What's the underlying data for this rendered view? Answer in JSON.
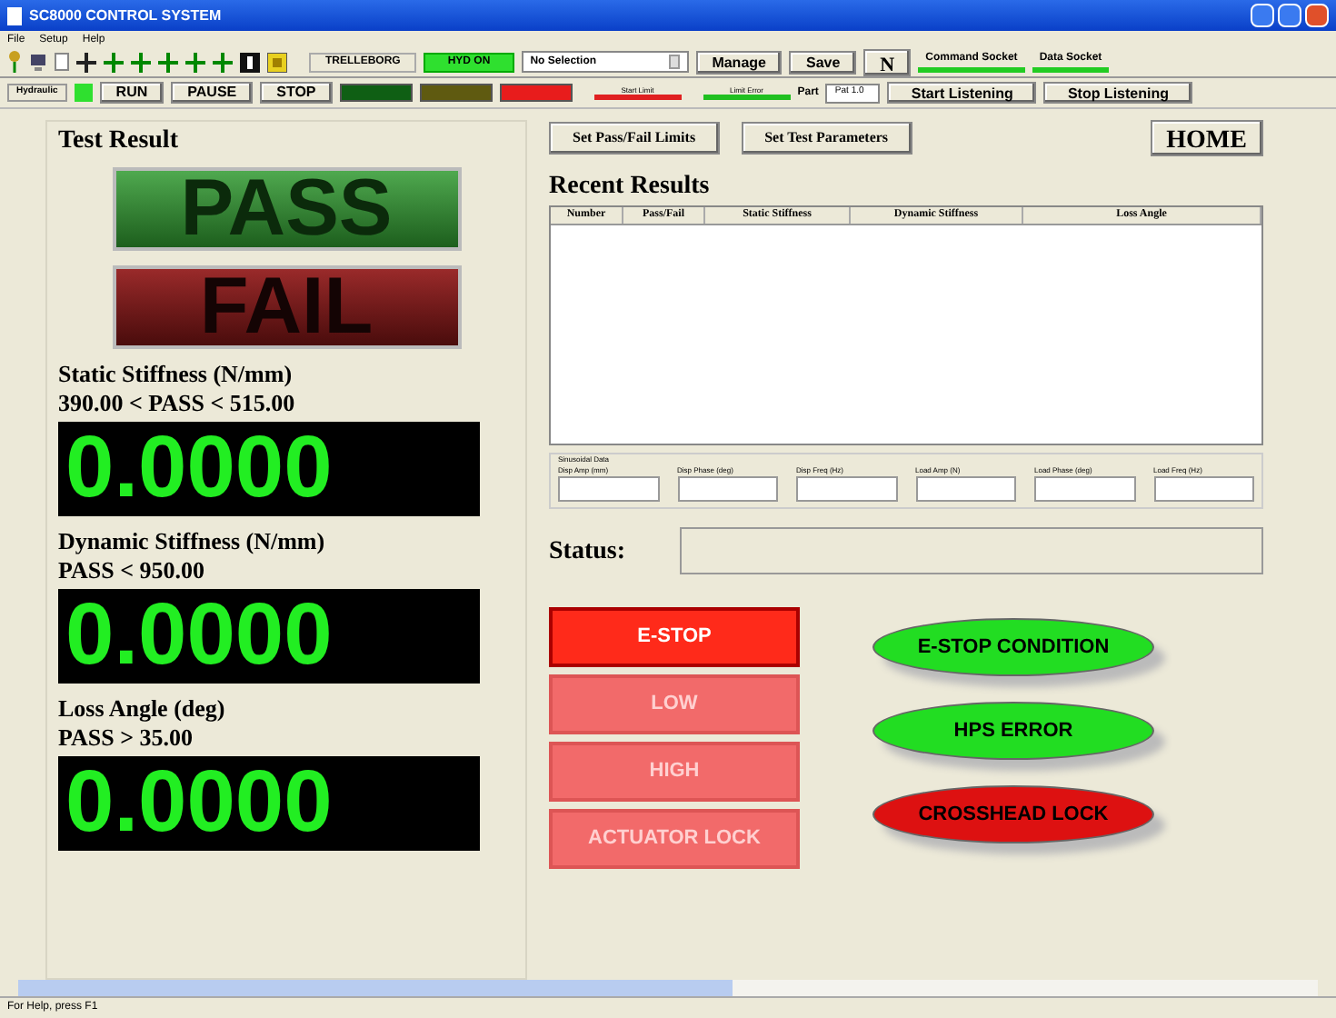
{
  "window": {
    "title": "SC8000 CONTROL SYSTEM"
  },
  "menu": [
    "File",
    "Setup",
    "Help"
  ],
  "toolbar": {
    "company": "TRELLEBORG",
    "hydraulics": "HYD ON",
    "selection": "No Selection",
    "buttons": [
      "Manage",
      "Save"
    ],
    "n_button": "N",
    "sockets": [
      {
        "label": "Command Socket",
        "connected": true
      },
      {
        "label": "Data Socket",
        "connected": true
      }
    ]
  },
  "control_bar": {
    "mode": "Hydraulic",
    "mode_on": true,
    "run_buttons": [
      "RUN",
      "PAUSE",
      "STOP"
    ],
    "lamps": [
      {
        "color": "#0f5f14"
      },
      {
        "color": "#5f5a10"
      },
      {
        "color": "#e81c1c"
      }
    ],
    "limit_bars": [
      {
        "label": "Start Limit",
        "color": "#e02020"
      },
      {
        "label": "Limit Error",
        "color": "#20c020"
      }
    ],
    "part_label": "Part",
    "part_value": "Pat 1.0",
    "listen_buttons": [
      "Start Listening",
      "Stop Listening"
    ]
  },
  "test_result": {
    "title": "Test Result",
    "pass": "PASS",
    "fail": "FAIL",
    "measurements": [
      {
        "title": "Static Stiffness (N/mm)",
        "limit": "390.00 < PASS < 515.00",
        "value": "0.0000"
      },
      {
        "title": "Dynamic Stiffness (N/mm)",
        "limit": "PASS < 950.00",
        "value": "0.0000"
      },
      {
        "title": "Loss Angle (deg)",
        "limit": "PASS > 35.00",
        "value": "0.0000"
      }
    ]
  },
  "actions": [
    "Set Pass/Fail Limits",
    "Set Test Parameters"
  ],
  "home": "HOME",
  "recent_results": {
    "title": "Recent Results",
    "columns": [
      "Number",
      "Pass/Fail",
      "Static Stiffness",
      "Dynamic Stiffness",
      "Loss Angle"
    ]
  },
  "sine_data": {
    "title": "Sinusoidal Data",
    "fields": [
      "Disp Amp (mm)",
      "Disp Phase (deg)",
      "Disp Freq (Hz)",
      "Load Amp (N)",
      "Load Phase (deg)",
      "Load Freq (Hz)"
    ]
  },
  "status": {
    "label": "Status:"
  },
  "alarms": [
    {
      "label": "E-STOP",
      "active": true
    },
    {
      "label": "LOW",
      "active": false
    },
    {
      "label": "HIGH",
      "active": false
    },
    {
      "label": "ACTUATOR LOCK",
      "active": false
    }
  ],
  "indicators": [
    {
      "label": "E-STOP CONDITION",
      "color": "#22dd22"
    },
    {
      "label": "HPS ERROR",
      "color": "#22dd22"
    },
    {
      "label": "CROSSHEAD LOCK",
      "color": "#dd1111"
    }
  ],
  "status_bar": {
    "text": "For Help, press F1"
  }
}
